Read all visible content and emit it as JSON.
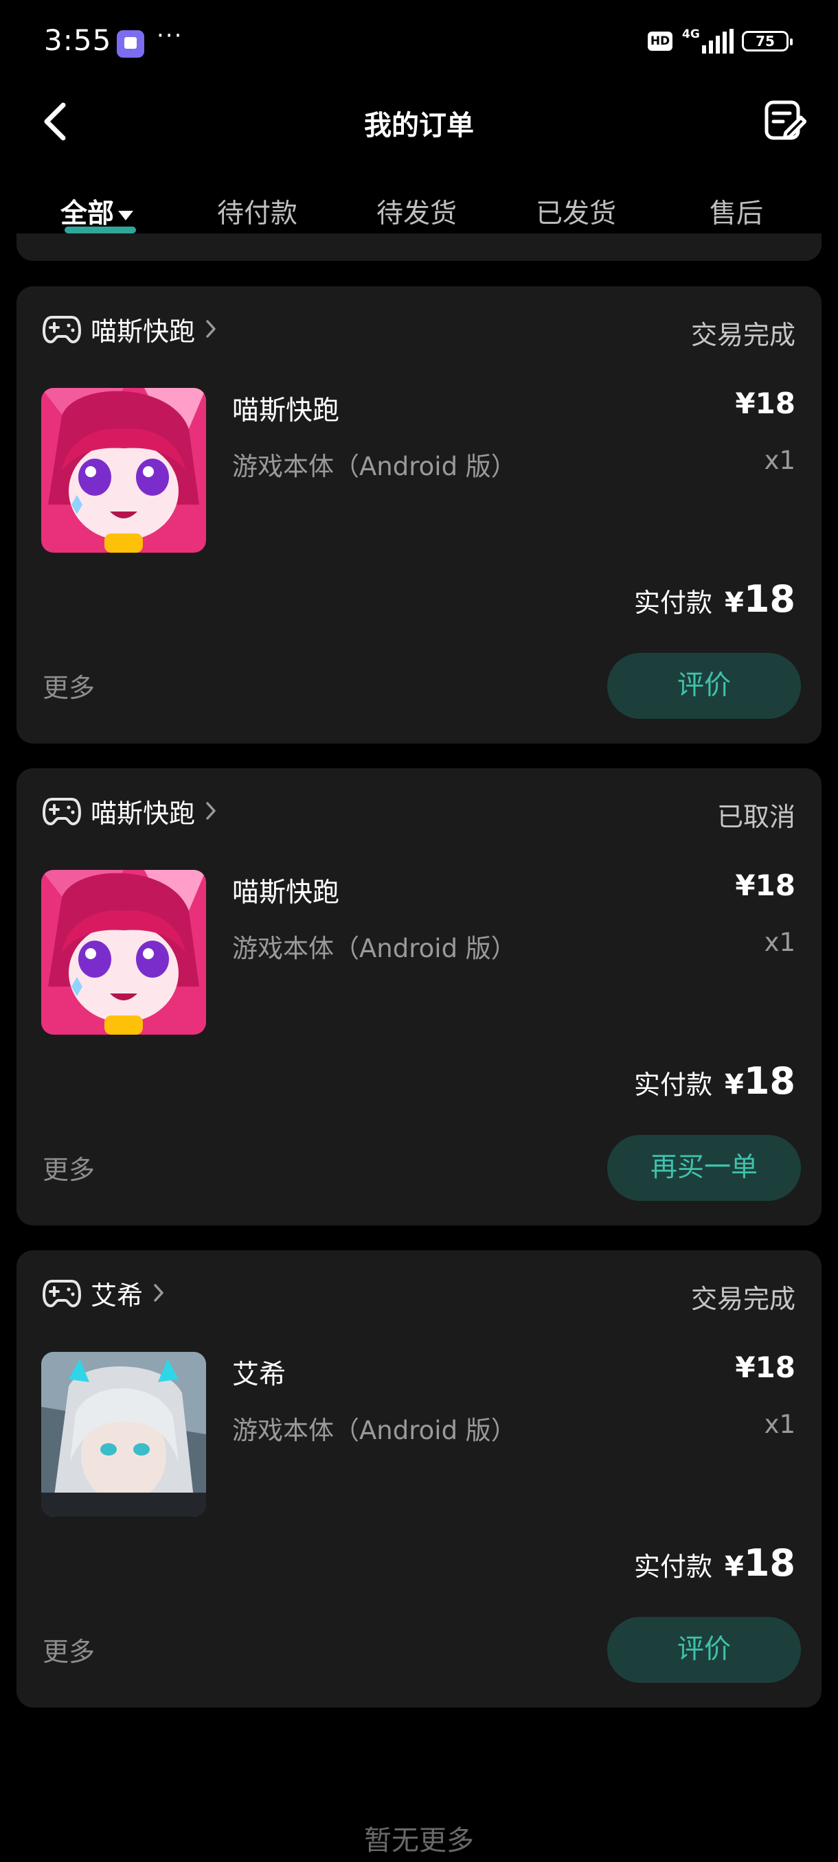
{
  "status_bar": {
    "time": "3:55",
    "dots": "···",
    "hd": "HD",
    "network": "4G",
    "battery": "75"
  },
  "header": {
    "title": "我的订单"
  },
  "tabs": [
    {
      "label": "全部",
      "active": true
    },
    {
      "label": "待付款"
    },
    {
      "label": "待发货"
    },
    {
      "label": "已发货"
    },
    {
      "label": "售后"
    }
  ],
  "orders": [
    {
      "shop": "喵斯快跑",
      "status": "交易完成",
      "product": "喵斯快跑",
      "variant": "游戏本体（Android 版）",
      "price": "¥18",
      "qty": "x1",
      "paid_label": "实付款",
      "paid_currency": "¥",
      "paid_amount": "18",
      "more": "更多",
      "action": "评价"
    },
    {
      "shop": "喵斯快跑",
      "status": "已取消",
      "product": "喵斯快跑",
      "variant": "游戏本体（Android 版）",
      "price": "¥18",
      "qty": "x1",
      "paid_label": "实付款",
      "paid_currency": "¥",
      "paid_amount": "18",
      "more": "更多",
      "action": "再买一单"
    },
    {
      "shop": "艾希",
      "status": "交易完成",
      "product": "艾希",
      "variant": "游戏本体（Android 版）",
      "price": "¥18",
      "qty": "x1",
      "paid_label": "实付款",
      "paid_currency": "¥",
      "paid_amount": "18",
      "more": "更多",
      "action": "评价"
    }
  ],
  "footer": {
    "no_more": "暂无更多"
  },
  "colors": {
    "background": "#000000",
    "card": "#1b1b1b",
    "accent": "#3fc2ad",
    "button_bg": "#1d3f3b",
    "tab_indicator": "#2fa69a"
  }
}
